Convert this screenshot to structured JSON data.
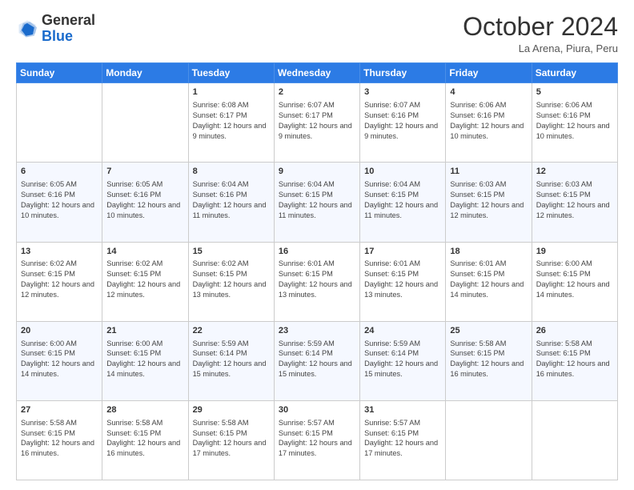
{
  "header": {
    "logo": {
      "line1": "General",
      "line2": "Blue"
    },
    "title": "October 2024",
    "subtitle": "La Arena, Piura, Peru"
  },
  "days_of_week": [
    "Sunday",
    "Monday",
    "Tuesday",
    "Wednesday",
    "Thursday",
    "Friday",
    "Saturday"
  ],
  "weeks": [
    [
      {
        "day": "",
        "info": ""
      },
      {
        "day": "",
        "info": ""
      },
      {
        "day": "1",
        "info": "Sunrise: 6:08 AM\nSunset: 6:17 PM\nDaylight: 12 hours and 9 minutes."
      },
      {
        "day": "2",
        "info": "Sunrise: 6:07 AM\nSunset: 6:17 PM\nDaylight: 12 hours and 9 minutes."
      },
      {
        "day": "3",
        "info": "Sunrise: 6:07 AM\nSunset: 6:16 PM\nDaylight: 12 hours and 9 minutes."
      },
      {
        "day": "4",
        "info": "Sunrise: 6:06 AM\nSunset: 6:16 PM\nDaylight: 12 hours and 10 minutes."
      },
      {
        "day": "5",
        "info": "Sunrise: 6:06 AM\nSunset: 6:16 PM\nDaylight: 12 hours and 10 minutes."
      }
    ],
    [
      {
        "day": "6",
        "info": "Sunrise: 6:05 AM\nSunset: 6:16 PM\nDaylight: 12 hours and 10 minutes."
      },
      {
        "day": "7",
        "info": "Sunrise: 6:05 AM\nSunset: 6:16 PM\nDaylight: 12 hours and 10 minutes."
      },
      {
        "day": "8",
        "info": "Sunrise: 6:04 AM\nSunset: 6:16 PM\nDaylight: 12 hours and 11 minutes."
      },
      {
        "day": "9",
        "info": "Sunrise: 6:04 AM\nSunset: 6:15 PM\nDaylight: 12 hours and 11 minutes."
      },
      {
        "day": "10",
        "info": "Sunrise: 6:04 AM\nSunset: 6:15 PM\nDaylight: 12 hours and 11 minutes."
      },
      {
        "day": "11",
        "info": "Sunrise: 6:03 AM\nSunset: 6:15 PM\nDaylight: 12 hours and 12 minutes."
      },
      {
        "day": "12",
        "info": "Sunrise: 6:03 AM\nSunset: 6:15 PM\nDaylight: 12 hours and 12 minutes."
      }
    ],
    [
      {
        "day": "13",
        "info": "Sunrise: 6:02 AM\nSunset: 6:15 PM\nDaylight: 12 hours and 12 minutes."
      },
      {
        "day": "14",
        "info": "Sunrise: 6:02 AM\nSunset: 6:15 PM\nDaylight: 12 hours and 12 minutes."
      },
      {
        "day": "15",
        "info": "Sunrise: 6:02 AM\nSunset: 6:15 PM\nDaylight: 12 hours and 13 minutes."
      },
      {
        "day": "16",
        "info": "Sunrise: 6:01 AM\nSunset: 6:15 PM\nDaylight: 12 hours and 13 minutes."
      },
      {
        "day": "17",
        "info": "Sunrise: 6:01 AM\nSunset: 6:15 PM\nDaylight: 12 hours and 13 minutes."
      },
      {
        "day": "18",
        "info": "Sunrise: 6:01 AM\nSunset: 6:15 PM\nDaylight: 12 hours and 14 minutes."
      },
      {
        "day": "19",
        "info": "Sunrise: 6:00 AM\nSunset: 6:15 PM\nDaylight: 12 hours and 14 minutes."
      }
    ],
    [
      {
        "day": "20",
        "info": "Sunrise: 6:00 AM\nSunset: 6:15 PM\nDaylight: 12 hours and 14 minutes."
      },
      {
        "day": "21",
        "info": "Sunrise: 6:00 AM\nSunset: 6:15 PM\nDaylight: 12 hours and 14 minutes."
      },
      {
        "day": "22",
        "info": "Sunrise: 5:59 AM\nSunset: 6:14 PM\nDaylight: 12 hours and 15 minutes."
      },
      {
        "day": "23",
        "info": "Sunrise: 5:59 AM\nSunset: 6:14 PM\nDaylight: 12 hours and 15 minutes."
      },
      {
        "day": "24",
        "info": "Sunrise: 5:59 AM\nSunset: 6:14 PM\nDaylight: 12 hours and 15 minutes."
      },
      {
        "day": "25",
        "info": "Sunrise: 5:58 AM\nSunset: 6:15 PM\nDaylight: 12 hours and 16 minutes."
      },
      {
        "day": "26",
        "info": "Sunrise: 5:58 AM\nSunset: 6:15 PM\nDaylight: 12 hours and 16 minutes."
      }
    ],
    [
      {
        "day": "27",
        "info": "Sunrise: 5:58 AM\nSunset: 6:15 PM\nDaylight: 12 hours and 16 minutes."
      },
      {
        "day": "28",
        "info": "Sunrise: 5:58 AM\nSunset: 6:15 PM\nDaylight: 12 hours and 16 minutes."
      },
      {
        "day": "29",
        "info": "Sunrise: 5:58 AM\nSunset: 6:15 PM\nDaylight: 12 hours and 17 minutes."
      },
      {
        "day": "30",
        "info": "Sunrise: 5:57 AM\nSunset: 6:15 PM\nDaylight: 12 hours and 17 minutes."
      },
      {
        "day": "31",
        "info": "Sunrise: 5:57 AM\nSunset: 6:15 PM\nDaylight: 12 hours and 17 minutes."
      },
      {
        "day": "",
        "info": ""
      },
      {
        "day": "",
        "info": ""
      }
    ]
  ]
}
